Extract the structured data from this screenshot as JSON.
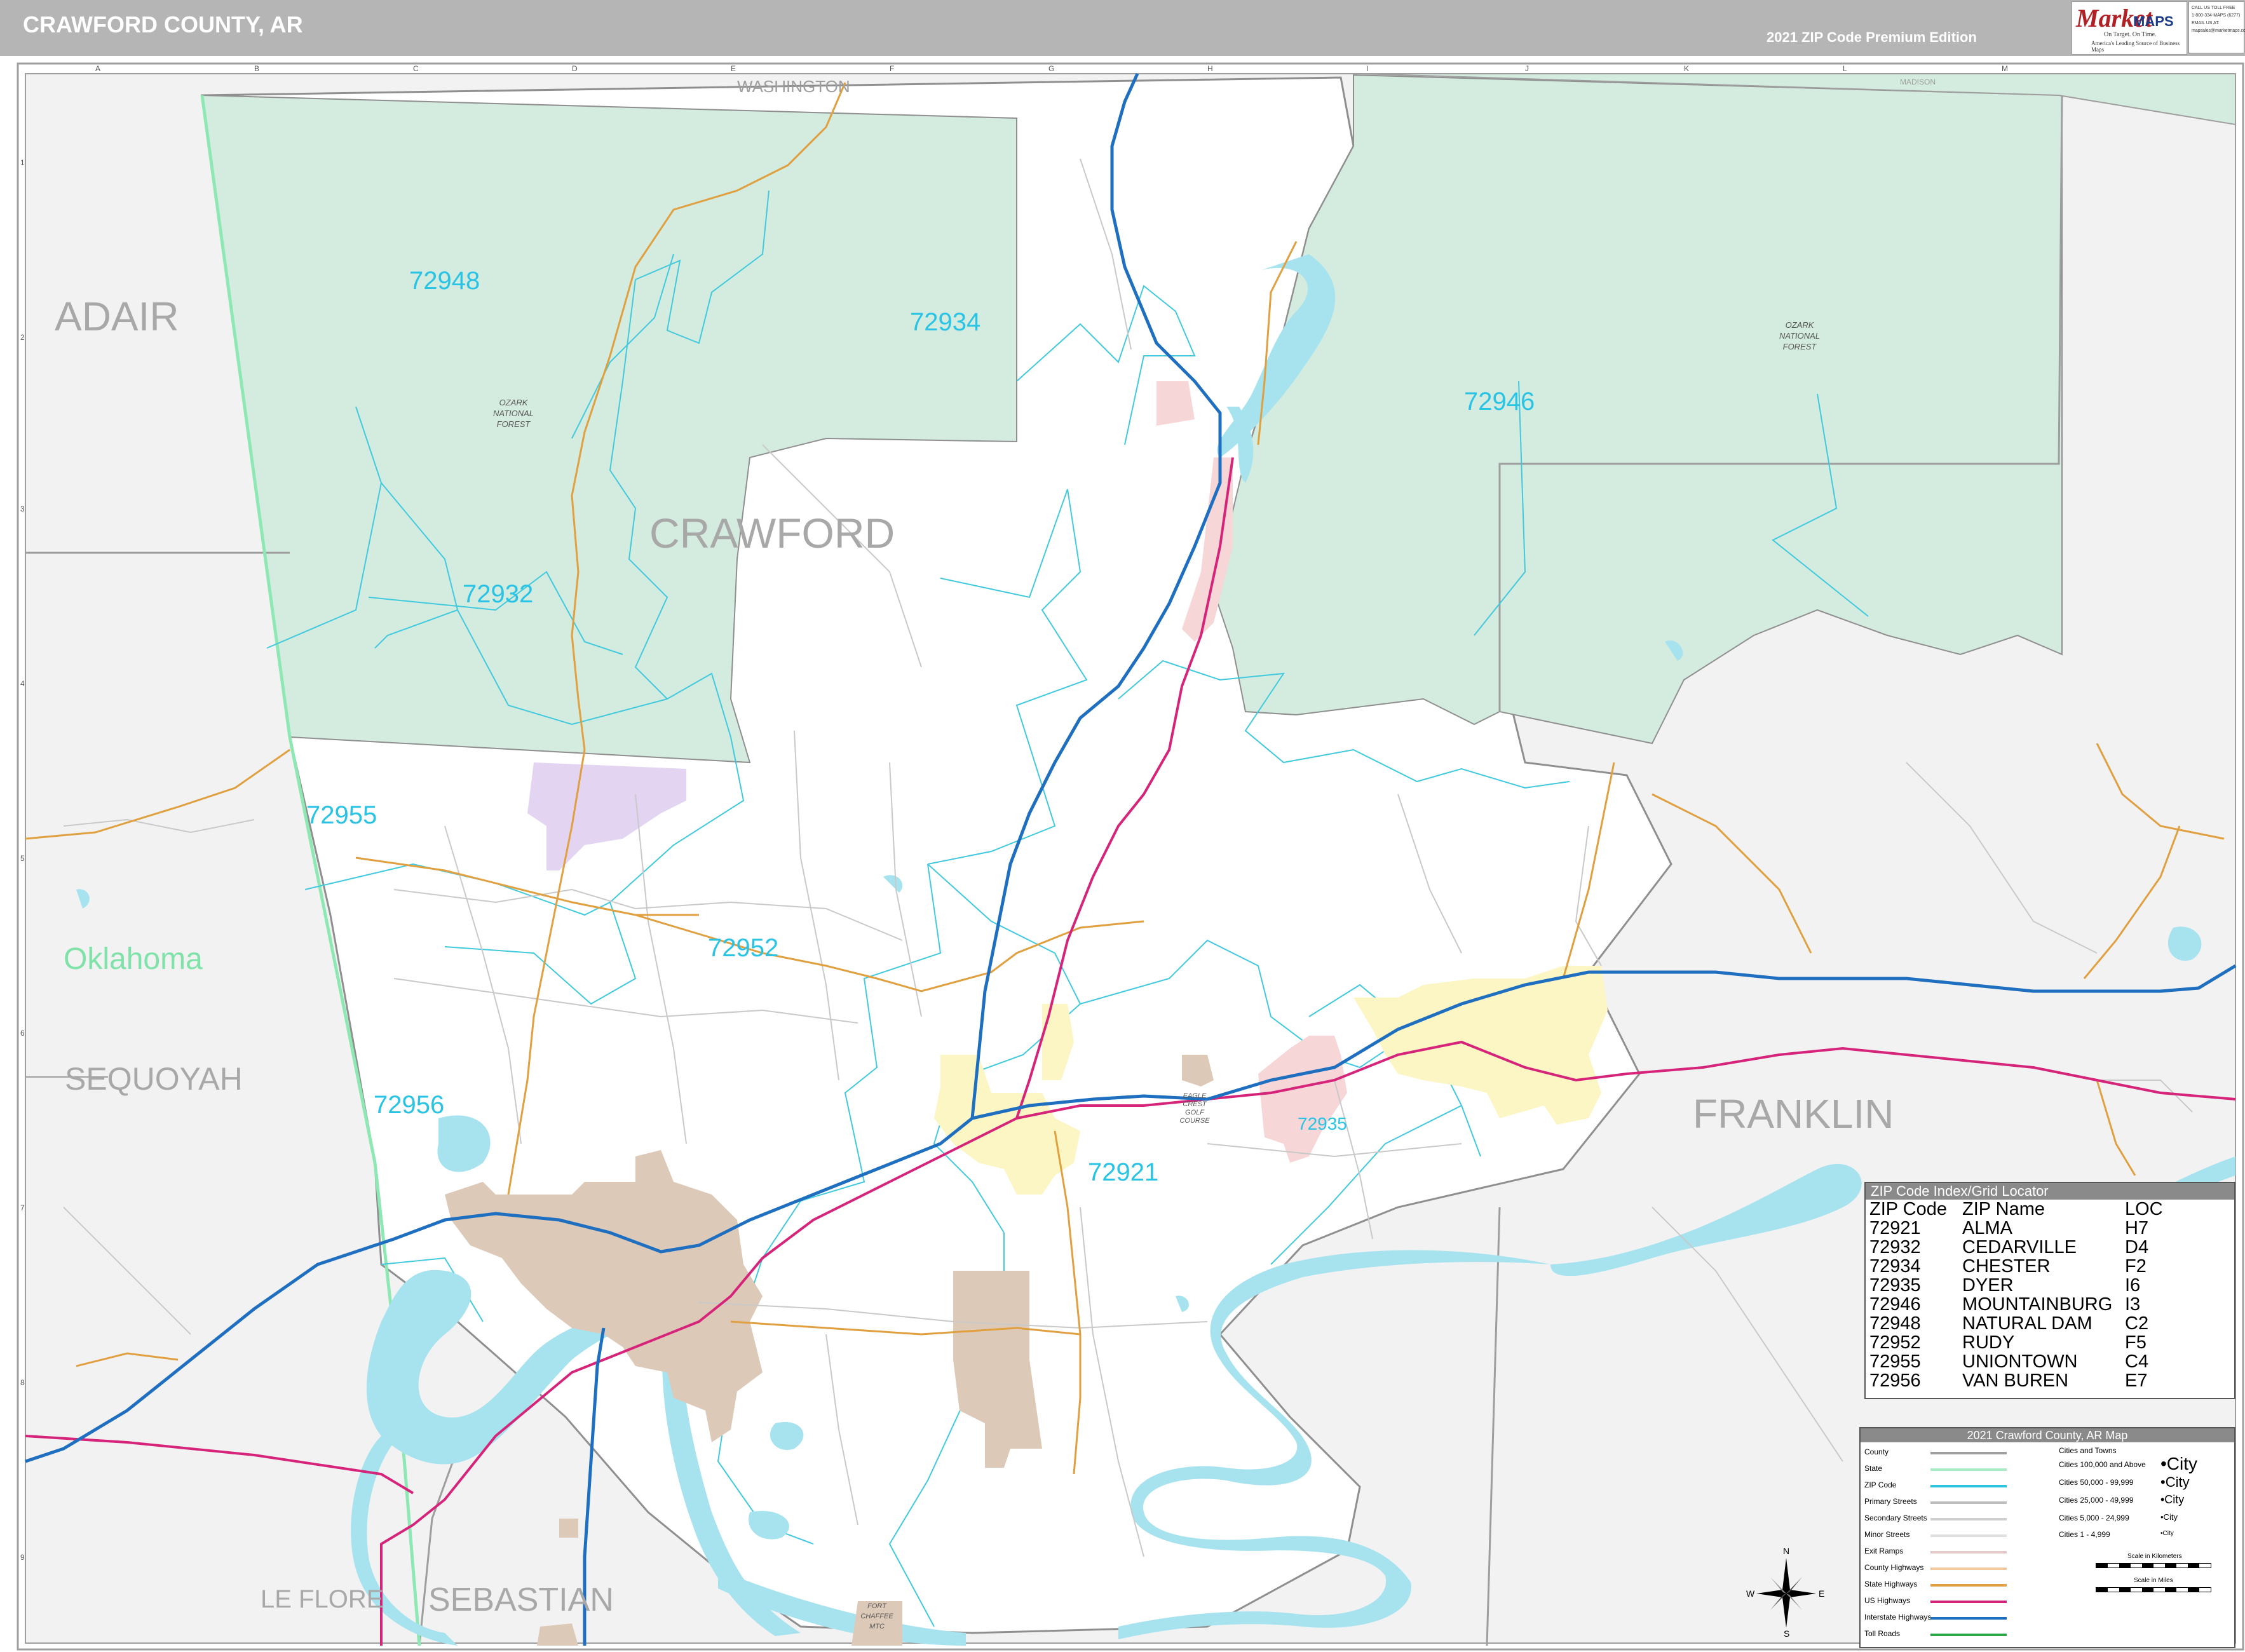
{
  "header": {
    "title": "CRAWFORD COUNTY, AR",
    "edition": "2021 ZIP Code Premium Edition"
  },
  "logo": {
    "brand_market": "Market",
    "brand_maps": "MAPS",
    "tagline_1": "On Target. On Time.",
    "tagline_2": "America's Leading Source of Business Maps"
  },
  "contact": {
    "line1": "CALL US TOLL FREE",
    "line2": "1-800-334-MAPS (6277)",
    "line3": "EMAIL US AT:",
    "line4": "mapsales@marketmaps.com"
  },
  "grid": {
    "columns": [
      "A",
      "B",
      "C",
      "D",
      "E",
      "F",
      "G",
      "H",
      "I",
      "J",
      "K",
      "L",
      "M"
    ],
    "rows": [
      "1",
      "2",
      "3",
      "4",
      "5",
      "6",
      "7",
      "8",
      "9"
    ]
  },
  "regions": {
    "washington": "WASHINGTON",
    "madison": "MADISON",
    "adair": "ADAIR",
    "crawford": "CRAWFORD",
    "oklahoma": "Oklahoma",
    "sequoyah": "SEQUOYAH",
    "franklin": "FRANKLIN",
    "le_flore": "LE FLORE",
    "sebastian": "SEBASTIAN"
  },
  "forest_labels": {
    "west": [
      "OZARK",
      "NATIONAL",
      "FOREST"
    ],
    "east": [
      "OZARK",
      "NATIONAL",
      "FOREST"
    ]
  },
  "special_labels": {
    "golf": [
      "EAGLE",
      "CREST",
      "GOLF",
      "COURSE"
    ],
    "fort": [
      "FORT",
      "CHAFFEE",
      "MTC"
    ]
  },
  "zip_labels": [
    {
      "code": "72948"
    },
    {
      "code": "72934"
    },
    {
      "code": "72946"
    },
    {
      "code": "72932"
    },
    {
      "code": "72955"
    },
    {
      "code": "72952"
    },
    {
      "code": "72956"
    },
    {
      "code": "72935"
    },
    {
      "code": "72921"
    }
  ],
  "zip_index": {
    "title": "ZIP Code Index/Grid Locator",
    "columns": [
      "ZIP Code",
      "ZIP Name",
      "LOC"
    ],
    "rows": [
      [
        "72921",
        "ALMA",
        "H7"
      ],
      [
        "72932",
        "CEDARVILLE",
        "D4"
      ],
      [
        "72934",
        "CHESTER",
        "F2"
      ],
      [
        "72935",
        "DYER",
        "I6"
      ],
      [
        "72946",
        "MOUNTAINBURG",
        "I3"
      ],
      [
        "72948",
        "NATURAL DAM",
        "C2"
      ],
      [
        "72952",
        "RUDY",
        "F5"
      ],
      [
        "72955",
        "UNIONTOWN",
        "C4"
      ],
      [
        "72956",
        "VAN BUREN",
        "E7"
      ]
    ]
  },
  "legend": {
    "title": "2021 Crawford County, AR Map",
    "items": [
      {
        "label": "County",
        "color": "#9e9e9e"
      },
      {
        "label": "State",
        "color": "#a8ecc4"
      },
      {
        "label": "ZIP Code",
        "color": "#2dc6de"
      },
      {
        "label": "Primary Streets",
        "color": "#bdbdbd"
      },
      {
        "label": "Secondary Streets",
        "color": "#cfcfcf"
      },
      {
        "label": "Minor Streets",
        "color": "#e0e0e0"
      },
      {
        "label": "Exit Ramps",
        "color": "#e6c9c9"
      },
      {
        "label": "County Highways",
        "color": "#f0c9a0"
      },
      {
        "label": "State Highways",
        "color": "#e0a040"
      },
      {
        "label": "US Highways",
        "color": "#d6247a"
      },
      {
        "label": "Interstate Highways",
        "color": "#1f6fc0"
      },
      {
        "label": "Toll Roads",
        "color": "#2ea84a"
      }
    ],
    "cities_title": "Cities and Towns",
    "city_classes": [
      {
        "label": "Cities 100,000 and Above",
        "sample": "•City"
      },
      {
        "label": "Cities 50,000 - 99,999",
        "sample": "•City"
      },
      {
        "label": "Cities 25,000 - 49,999",
        "sample": "•City"
      },
      {
        "label": "Cities 5,000 - 24,999",
        "sample": "•City"
      },
      {
        "label": "Cities 1 - 4,999",
        "sample": "•City"
      }
    ],
    "scale_km": "Scale in Kilometers",
    "scale_mi": "Scale in Miles"
  },
  "compass": {
    "n": "N",
    "s": "S",
    "e": "E",
    "w": "W"
  },
  "colors": {
    "forest": "#d4ebdf",
    "outside": "#f2f2f2",
    "water": "#a6e3ef",
    "zip_text": "#29c3e5",
    "zip_boundary": "#41c9de",
    "county_text": "#a8a8a8",
    "oklahoma_text": "#7fe2a8",
    "city_tan": "#ddc9b8",
    "city_yellow": "#fbf6c4",
    "city_pink": "#f6d6d6",
    "city_purple": "#e3d5f2",
    "interstate": "#1f6fc0",
    "us_highway": "#d6247a",
    "state_highway": "#e0a040"
  }
}
